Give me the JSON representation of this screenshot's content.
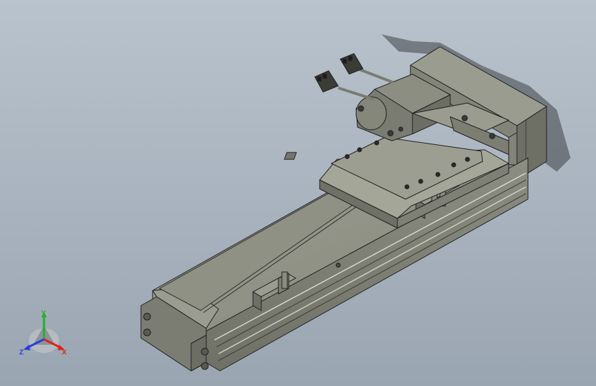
{
  "viewport": {
    "background_top": "#b9c3cd",
    "background_bottom": "#9aa5b2"
  },
  "model": {
    "body_color": "#8a8c80",
    "edge_color": "#1e1e1e"
  },
  "triad": {
    "x_label": "X",
    "y_label": "Y",
    "z_label": "Z",
    "x_color": "#e0201a",
    "y_color": "#22b02a",
    "z_color": "#2a3cd8"
  }
}
